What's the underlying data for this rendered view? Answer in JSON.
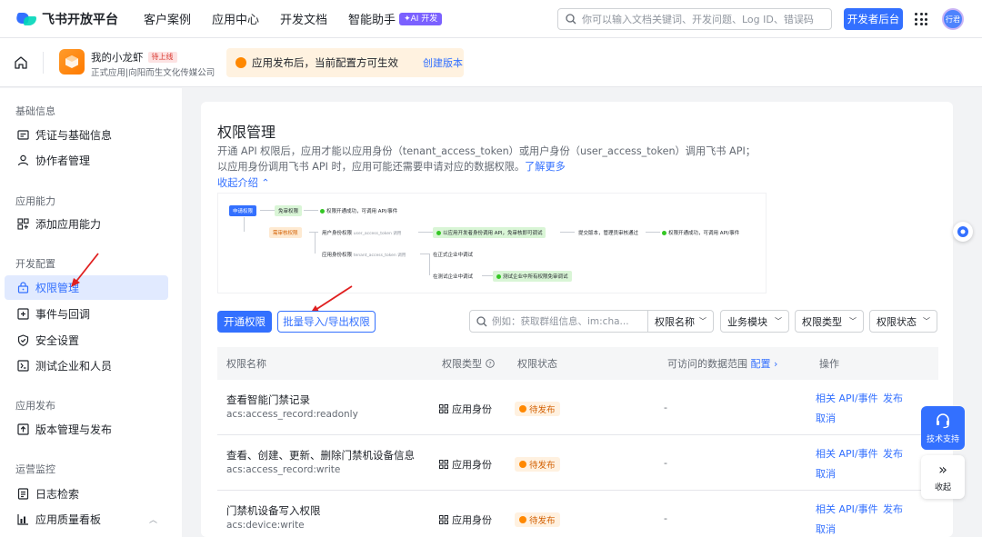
{
  "topnav": {
    "logo": "飞书开放平台",
    "links": [
      "客户案例",
      "应用中心",
      "开发文档",
      "智能助手"
    ],
    "ai_badge": "✦AI 开发",
    "search_placeholder": "你可以输入文档关键词、开发问题、Log ID、错误码",
    "dev_console": "开发者后台",
    "avatar_text": "行君"
  },
  "appbar": {
    "app_name": "我的小龙虾",
    "badge": "待上线",
    "subtitle": "正式应用|向阳而生文化传媒公司",
    "notice": "应用发布后，当前配置方可生效",
    "notice_link": "创建版本"
  },
  "sidebar": {
    "groups": [
      "基础信息",
      "应用能力",
      "开发配置",
      "应用发布",
      "运营监控"
    ],
    "items": [
      {
        "label": "凭证与基础信息",
        "icon": "credential-icon"
      },
      {
        "label": "协作者管理",
        "icon": "user-icon"
      },
      {
        "label": "添加应用能力",
        "icon": "apps-icon"
      },
      {
        "label": "权限管理",
        "icon": "lock-icon"
      },
      {
        "label": "事件与回调",
        "icon": "event-icon"
      },
      {
        "label": "安全设置",
        "icon": "shield-icon"
      },
      {
        "label": "测试企业和人员",
        "icon": "test-icon"
      },
      {
        "label": "版本管理与发布",
        "icon": "upload-icon"
      },
      {
        "label": "日志检索",
        "icon": "log-icon"
      },
      {
        "label": "应用质量看板",
        "icon": "chart-icon"
      }
    ]
  },
  "main": {
    "title": "权限管理",
    "desc": "开通 API 权限后，应用才能以应用身份（tenant_access_token）或用户身份（user_access_token）调用飞书 API；以应用身份调用飞书 API 时，应用可能还需要申请对应的数据权限。",
    "learn_more": "了解更多",
    "collapse": "收起介绍 ⌃",
    "flow": {
      "apply": "申请权限",
      "free": "免审权限",
      "free_result": "权限开通成功，可调用 API/事件",
      "review": "需审核权限",
      "user_identity": "用户身份权限",
      "user_token": "user_access_token 调用",
      "app_identity": "应用身份权限",
      "tenant_token": "tenant_access_token 调用",
      "debug_call": "以应用开发者身份调用 API，免审核即可调试",
      "submit": "提交版本，管理员审核通过",
      "final_result": "权限开通成功，可调用 API/事件",
      "formal_debug": "在正式企业中调试",
      "test_debug": "在测试企业中调试",
      "test_result": "测试企业中所有权限免审调试"
    },
    "btn_open": "开通权限",
    "btn_batch": "批量导入/导出权限",
    "filter_placeholder": "例如：获取群组信息、im:cha...",
    "filters": [
      "权限名称",
      "业务模块",
      "权限类型",
      "权限状态"
    ],
    "columns": [
      "权限名称",
      "权限类型",
      "权限状态",
      "可访问的数据范围",
      "配置",
      "操作"
    ],
    "rows": [
      {
        "name": "查看智能门禁记录",
        "code": "acs:access_record:readonly",
        "type": "应用身份",
        "status": "待发布",
        "range": "-",
        "ops": [
          "相关 API/事件",
          "发布",
          "取消"
        ]
      },
      {
        "name": "查看、创建、更新、删除门禁机设备信息",
        "code": "acs:access_record:write",
        "type": "应用身份",
        "status": "待发布",
        "range": "-",
        "ops": [
          "相关 API/事件",
          "发布",
          "取消"
        ]
      },
      {
        "name": "门禁机设备写入权限",
        "code": "acs:device:write",
        "type": "应用身份",
        "status": "待发布",
        "range": "-",
        "ops": [
          "相关 API/事件",
          "发布",
          "取消"
        ]
      }
    ]
  },
  "floating": {
    "support": "技术支持",
    "collapse": "收起"
  },
  "colors": {
    "accent": "#3370ff",
    "warning": "#ff8800",
    "annotation": "#e02020"
  }
}
